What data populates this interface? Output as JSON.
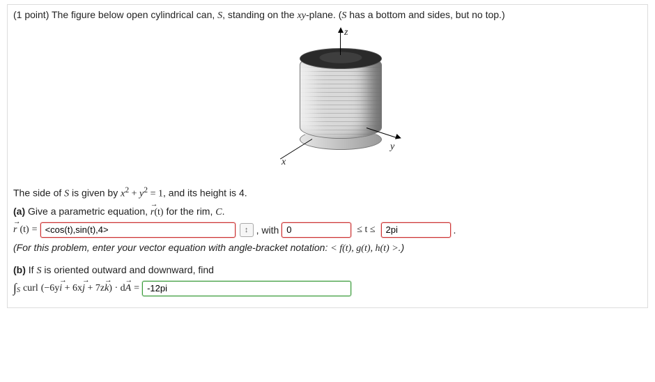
{
  "header": {
    "points": "(1 point)",
    "intro_a": "The figure below open cylindrical can, ",
    "S": "S",
    "intro_b": ", standing on the ",
    "xy": "xy",
    "intro_c": "-plane. (",
    "intro_d": " has a bottom and sides, but no top.)"
  },
  "axes": {
    "z": "z",
    "x": "x",
    "y": "y"
  },
  "caption": {
    "a": "The side of ",
    "S": "S",
    "b": " is given by ",
    "eq_lhs": "x",
    "eq_sup": "2",
    "eq_plus": " + ",
    "eq_y": "y",
    "eq_eq": " = 1",
    "c": ", and its height is 4."
  },
  "partA": {
    "label": "(a)",
    "text_a": " Give a parametric equation, ",
    "r": "r",
    "of_t": "(t)",
    "text_b": " for the rim, ",
    "C": "C",
    "r_eq": " = ",
    "answer": "<cos(t),sin(t),4>",
    "with": ", with",
    "t_low": "0",
    "le": "≤ t ≤",
    "t_high": "2pi",
    "hint_a": "(For this problem, enter your vector equation with angle-bracket notation: ",
    "hint_lt": "<",
    "hint_f": " f(t), g(t), h(t) ",
    "hint_gt": ">",
    "hint_b": ".)"
  },
  "partB": {
    "label": "(b)",
    "text_a": " If ",
    "S": "S",
    "text_b": " is oriented outward and downward, find",
    "curl": "curl",
    "vf_a": "(−6y",
    "i": "i",
    "vf_b": " + 6x",
    "j": "j",
    "vf_c": " + 7z",
    "k": "k",
    "vf_d": ") · d",
    "A": "A",
    "eq": " = ",
    "answer": "-12pi"
  }
}
